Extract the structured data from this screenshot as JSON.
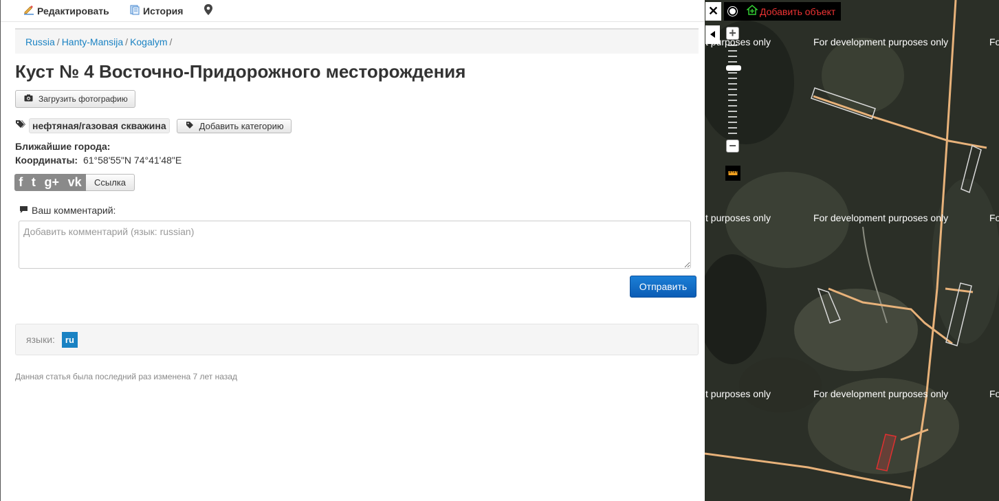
{
  "topnav": {
    "edit_label": "Редактировать",
    "history_label": "История"
  },
  "breadcrumb": [
    "Russia",
    "Hanty-Mansija",
    "Kogalym"
  ],
  "title": "Куст № 4 Восточно-Придорожного месторождения",
  "upload_photo_label": "Загрузить фотографию",
  "tags": {
    "category": "нефтяная/газовая скважина",
    "add_category_label": "Добавить категорию"
  },
  "info": {
    "nearby_label": "Ближайшие города:",
    "coords_label": "Координаты:",
    "coords_value": "61°58'55\"N 74°41'48\"E"
  },
  "share": {
    "icons": [
      "f",
      "t",
      "g+",
      "vk"
    ],
    "link_label": "Ссылка"
  },
  "comment": {
    "label": "Ваш комментарий:",
    "placeholder": "Добавить комментарий (язык: russian)",
    "value": "",
    "send_label": "Отправить"
  },
  "languages": {
    "label": "языки:",
    "items": [
      "ru"
    ]
  },
  "footer_note": "Данная статья была последний раз изменена 7 лет назад",
  "map": {
    "close_label": "✕",
    "add_object_label": "Добавить объект",
    "watermark_full": "For development purposes only",
    "watermark_partial_left": "t purposes only",
    "watermark_partial_right": "Fo",
    "colors": {
      "road": "#e8b27a",
      "selected_outline": "#e03030",
      "outline": "#d9d9d9"
    }
  }
}
